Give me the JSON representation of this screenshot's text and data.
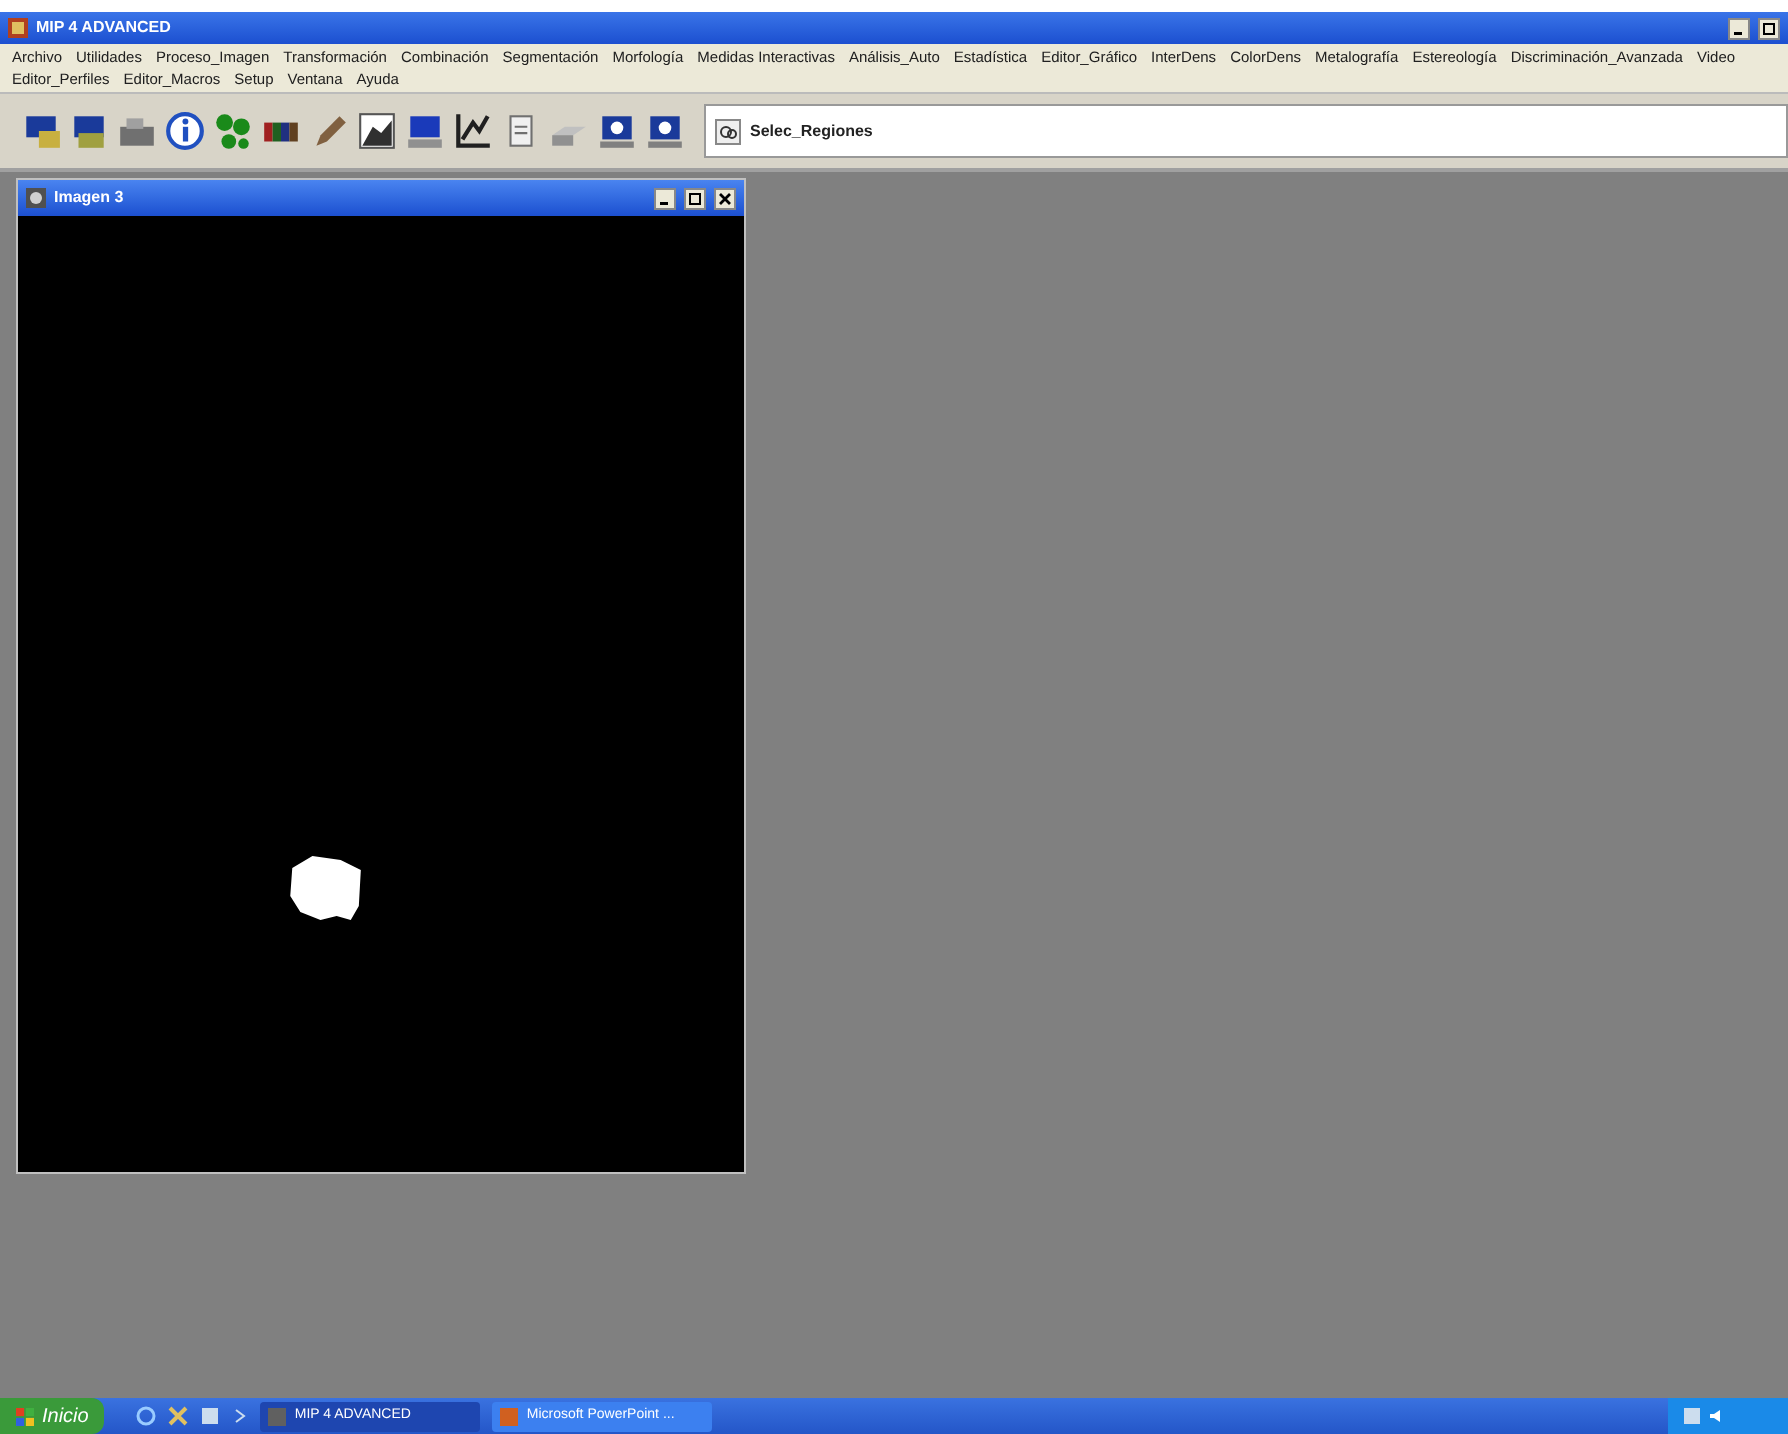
{
  "window": {
    "title": "MIP 4 ADVANCED"
  },
  "menu": {
    "items": [
      "Archivo",
      "Utilidades",
      "Proceso_Imagen",
      "Transformación",
      "Combinación",
      "Segmentación",
      "Morfología",
      "Medidas Interactivas",
      "Análisis_Auto",
      "Estadística",
      "Editor_Gráfico",
      "InterDens",
      "ColorDens",
      "Metalografía",
      "Estereología",
      "Discriminación_Avanzada",
      "Video",
      "Editor_Perfiles",
      "Editor_Macros",
      "Setup",
      "Ventana",
      "Ayuda"
    ]
  },
  "toolbar": {
    "combo": {
      "value": "Selec_Regiones"
    }
  },
  "image_window": {
    "title": "Imagen 3"
  },
  "taskbar": {
    "start": "Inicio",
    "tasks": [
      {
        "label": "MIP 4 ADVANCED",
        "selected": true
      },
      {
        "label": "Microsoft PowerPoint ...",
        "selected": false
      }
    ]
  }
}
